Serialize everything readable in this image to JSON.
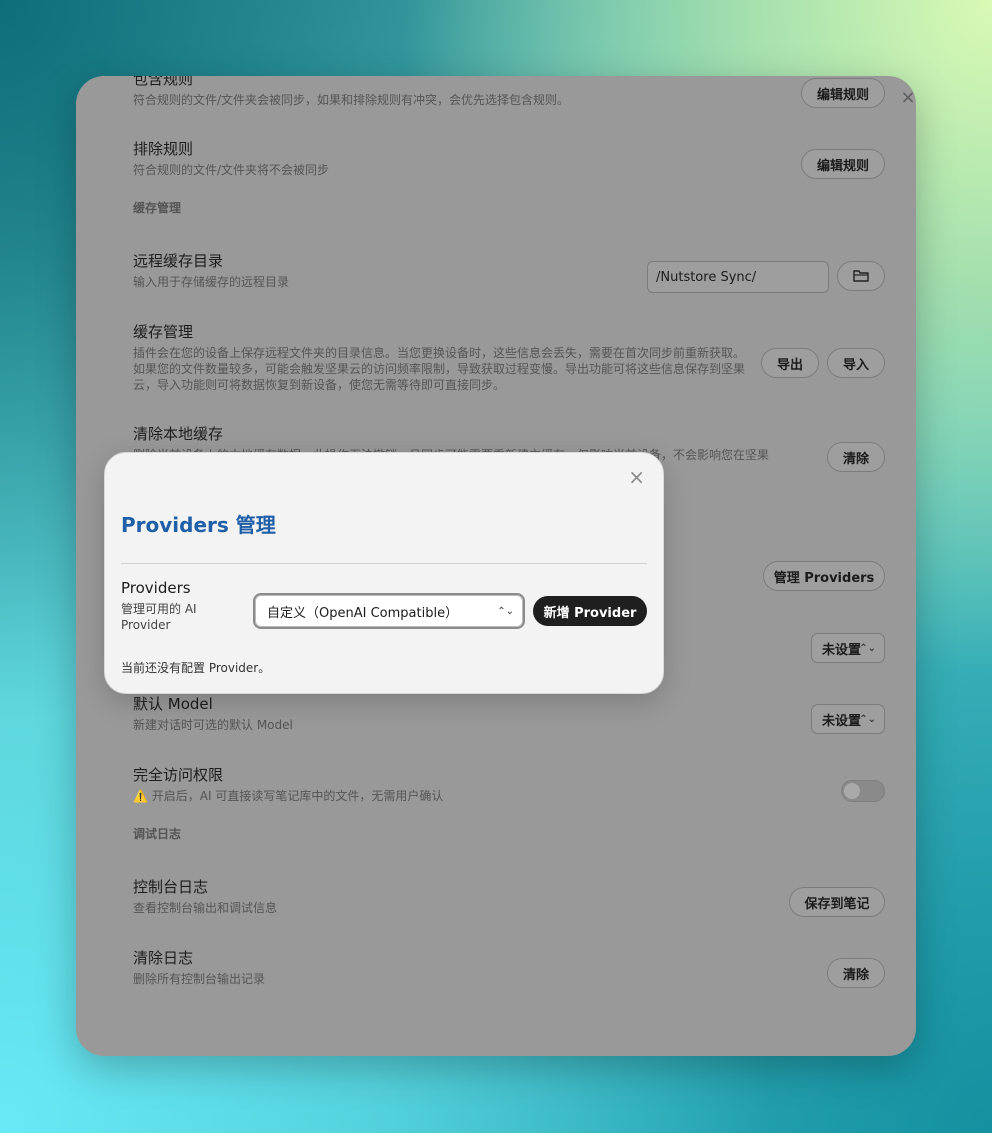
{
  "window": {
    "close_symbol": "×",
    "include_rules": {
      "title": "包含规则",
      "desc": "符合规则的文件/文件夹会被同步，如果和排除规则有冲突，会优先选择包含规则。",
      "button": "编辑规则"
    },
    "exclude_rules": {
      "title": "排除规则",
      "desc": "符合规则的文件/文件夹将不会被同步",
      "button": "编辑规则"
    },
    "cache_section": "缓存管理",
    "remote_cache_dir": {
      "title": "远程缓存目录",
      "desc": "输入用于存储缓存的远程目录",
      "value": "/Nutstore Sync/",
      "folder_icon": "folder-icon"
    },
    "cache_manage": {
      "title": "缓存管理",
      "desc": "插件会在您的设备上保存远程文件夹的目录信息。当您更换设备时，这些信息会丢失，需要在首次同步前重新获取。如果您的文件数量较多，可能会触发坚果云的访问频率限制，导致获取过程变慢。导出功能可将这些信息保存到坚果云，导入功能则可将数据恢复到新设备，使您无需等待即可直接同步。",
      "export_button": "导出",
      "import_button": "导入"
    },
    "clear_local_cache": {
      "title": "清除本地缓存",
      "desc": "删除当前设备上的本地缓存数据，此操作无法撤销，且同步可能需要重新建立缓存。仅影响当前设备，不会影响您在坚果",
      "button": "清除"
    },
    "manage_providers_button": "管理 Providers",
    "default_provider_select": "未设置",
    "default_model": {
      "title": "默认 Model",
      "desc": "新建对话时可选的默认 Model",
      "select": "未设置"
    },
    "full_access": {
      "title": "完全访问权限",
      "warning_icon": "⚠️",
      "desc": "开启后，AI 可直接读写笔记库中的文件，无需用户确认",
      "enabled": false
    },
    "debug_section": "调试日志",
    "console_log": {
      "title": "控制台日志",
      "desc": "查看控制台输出和调试信息",
      "button": "保存到笔记"
    },
    "clear_log": {
      "title": "清除日志",
      "desc": "删除所有控制台输出记录",
      "button": "清除"
    }
  },
  "modal": {
    "close_symbol": "×",
    "title": "Providers 管理",
    "providers_label": "Providers",
    "providers_desc": "管理可用的 AI Provider",
    "select_value": "自定义（OpenAI Compatible）",
    "add_button": "新增 Provider",
    "empty_text": "当前还没有配置 Provider。"
  }
}
